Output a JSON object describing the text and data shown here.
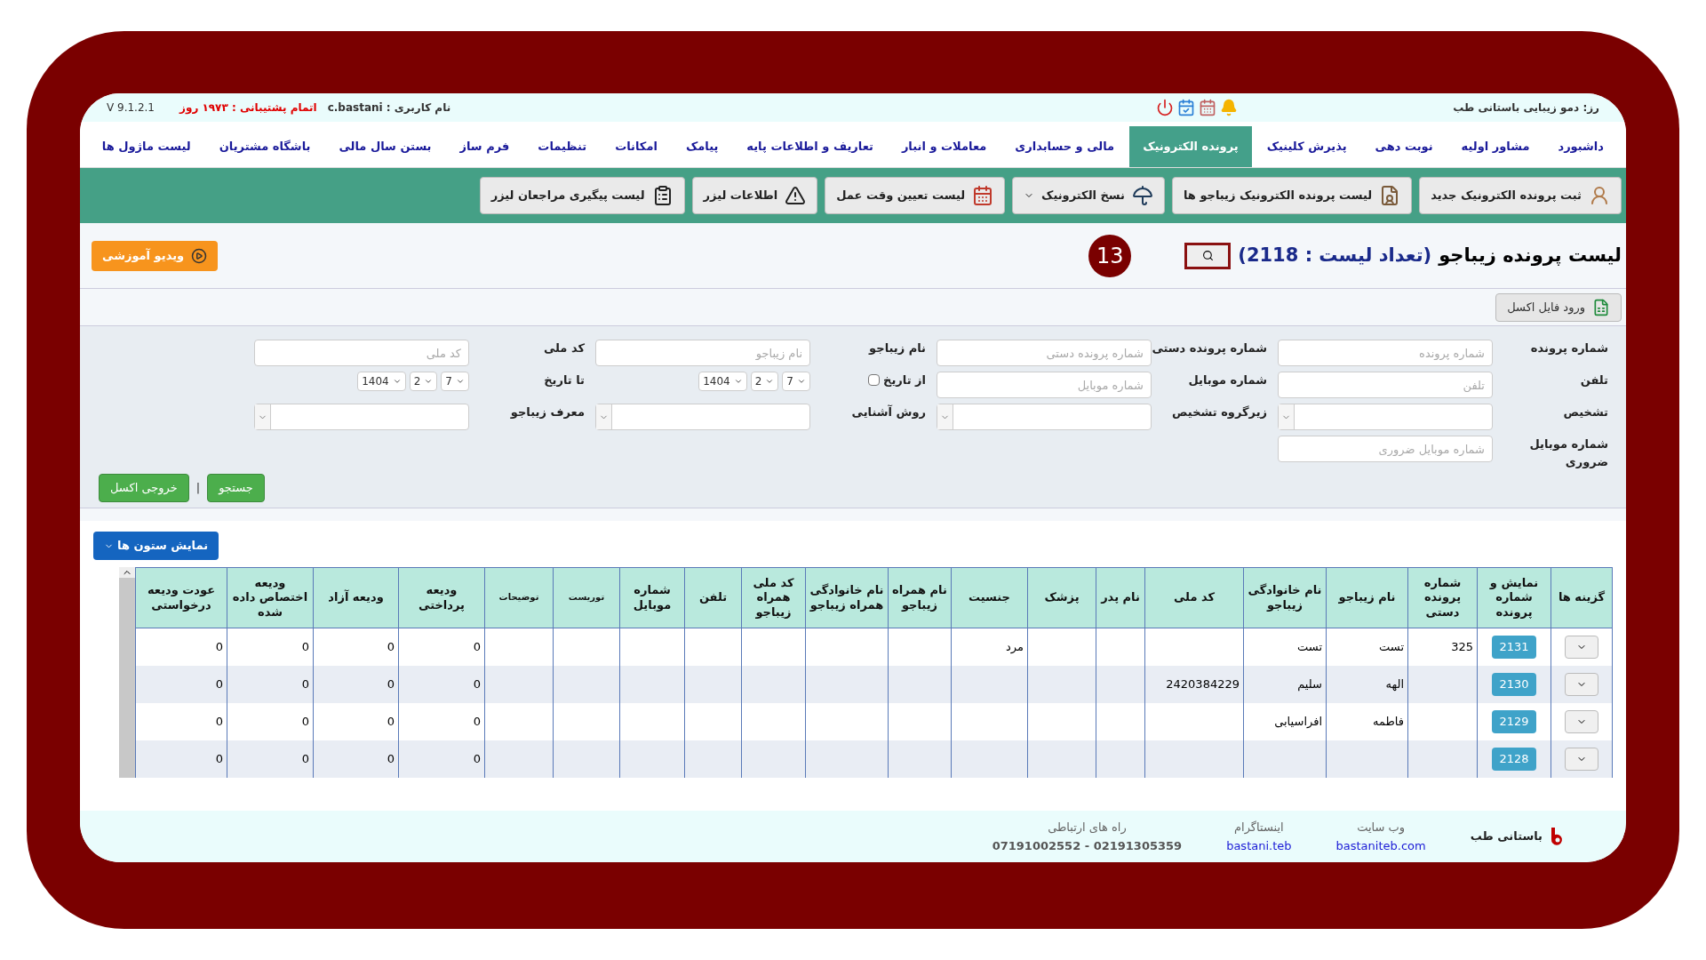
{
  "top_bar": {
    "site": "رز: دمو زیبایی باستانی طب",
    "user_label": "نام کاربری :",
    "user": "c.bastani",
    "support": "اتمام پشتیبانی : ۱۹۷۳ روز",
    "version": "V 9.1.2.1"
  },
  "nav": [
    {
      "label": "داشبورد",
      "selected": false
    },
    {
      "label": "مشاور اولیه",
      "selected": false
    },
    {
      "label": "نوبت دهی",
      "selected": false
    },
    {
      "label": "پذیرش کلینیک",
      "selected": false
    },
    {
      "label": "پرونده الکترونیک",
      "selected": true
    },
    {
      "label": "مالی و حسابداری",
      "selected": false
    },
    {
      "label": "معاملات و انبار",
      "selected": false
    },
    {
      "label": "تعاریف و اطلاعات پایه",
      "selected": false
    },
    {
      "label": "پیامک",
      "selected": false
    },
    {
      "label": "امکانات",
      "selected": false
    },
    {
      "label": "تنظیمات",
      "selected": false
    },
    {
      "label": "فرم ساز",
      "selected": false
    },
    {
      "label": "بستن سال مالی",
      "selected": false
    },
    {
      "label": "باشگاه مشتریان",
      "selected": false
    },
    {
      "label": "لیست ماژول ها",
      "selected": false
    }
  ],
  "toolbar": [
    {
      "label": "ثبت پرونده الکترونیک جدید",
      "kind": "person"
    },
    {
      "label": "لیست پرونده الکترونیک زیباجو ها",
      "kind": "document"
    },
    {
      "label": "نسخ الکترونیک",
      "kind": "umbrella"
    },
    {
      "label": "لیست تعیین وقت عمل",
      "kind": "calendar"
    },
    {
      "label": "اطلاعات لیزر",
      "kind": "warning"
    },
    {
      "label": "لیست پیگیری مراجعان لیزر",
      "kind": "clipboard"
    }
  ],
  "page_title": "لیست پرونده زیباجو",
  "count_text": "(تعداد لیست : 2118)",
  "badge": "13",
  "video_button": "ویدیو آموزشی",
  "excel_import": "ورود فایل اکسل",
  "filters": [
    [
      {
        "kind": "text",
        "label": "شماره پرونده",
        "placeholder": "شماره پرونده"
      },
      {
        "kind": "text",
        "label": "شماره پرونده دستی",
        "placeholder": "شماره پرونده دستی"
      },
      {
        "kind": "text",
        "label": "نام زیباجو",
        "placeholder": "نام زیباجو"
      },
      {
        "kind": "text",
        "label": "کد ملی",
        "placeholder": "کد ملی"
      }
    ],
    [
      {
        "kind": "text",
        "label": "تلفن",
        "placeholder": "تلفن"
      },
      {
        "kind": "text",
        "label": "شماره موبایل",
        "placeholder": "شماره موبایل"
      },
      {
        "kind": "date",
        "label": "از تاریخ",
        "checked": false,
        "day": "7",
        "month": "2",
        "year": "1404"
      },
      {
        "kind": "date",
        "label": "تا تاریخ",
        "day": "7",
        "month": "2",
        "year": "1404"
      }
    ],
    [
      {
        "kind": "select",
        "label": "تشخیص"
      },
      {
        "kind": "select",
        "label": "زیرگروه تشخیص"
      },
      {
        "kind": "select",
        "label": "روش آشنایی"
      },
      {
        "kind": "select",
        "label": "معرف زیباجو"
      }
    ],
    [
      {
        "kind": "text",
        "label": "شماره موبایل ضروری",
        "placeholder": "شماره موبایل ضروری"
      }
    ]
  ],
  "search_button": "جستجو",
  "separator": "|",
  "excel_export": "خروجی اکسل",
  "columns_button": "نمایش ستون ها",
  "table": {
    "columns": [
      "گزینه ها",
      "نمایش و شماره پرونده",
      "شماره پرونده دستی",
      "نام زیباجو",
      "نام خانوادگی زیباجو",
      "کد ملی",
      "نام پدر",
      "پزشک",
      "جنسیت",
      "نام همراه زیباجو",
      "نام خانوادگی همراه زیباجو",
      "کد ملی همراه زیباجو",
      "تلفن",
      "شماره موبایل",
      "توریست",
      "توضیحات",
      "ودیعه پرداختی",
      "ودیعه آزاد",
      "ودیعه اختصاص داده شده",
      "عودت ودیعه درخواستی"
    ],
    "rows": [
      {
        "cells": [
          "",
          "2131",
          "325",
          "تست",
          "تست",
          "",
          "",
          "",
          "مرد",
          "",
          "",
          "",
          "",
          "",
          "",
          "",
          "0",
          "0",
          "0",
          "0"
        ]
      },
      {
        "cells": [
          "",
          "2130",
          "",
          "الهه",
          "سلیم",
          "2420384229",
          "",
          "",
          "",
          "",
          "",
          "",
          "",
          "",
          "",
          "",
          "0",
          "0",
          "0",
          "0"
        ]
      },
      {
        "cells": [
          "",
          "2129",
          "",
          "فاطمه",
          "افراسیابی",
          "",
          "",
          "",
          "",
          "",
          "",
          "",
          "",
          "",
          "",
          "",
          "0",
          "0",
          "0",
          "0"
        ]
      },
      {
        "cells": [
          "",
          "2128",
          "",
          "",
          "",
          "",
          "",
          "",
          "",
          "",
          "",
          "",
          "",
          "",
          "",
          "",
          "0",
          "0",
          "0",
          "0"
        ]
      }
    ]
  },
  "footer": {
    "brand": "باستانی طب",
    "links": [
      {
        "label": "وب سایت",
        "value": "bastaniteb.com",
        "kind": "link"
      },
      {
        "label": "اینستاگرام",
        "value": "bastani.teb",
        "kind": "link"
      },
      {
        "label": "راه های ارتباطی",
        "value": "07191002552 - 02191305359",
        "kind": "text"
      }
    ]
  }
}
